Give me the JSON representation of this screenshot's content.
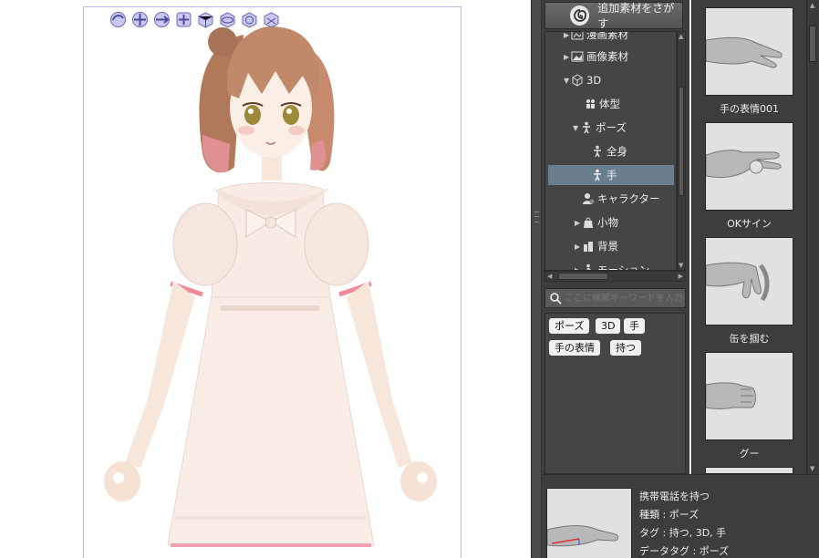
{
  "toolbar3d": {
    "icons": [
      "camera-rotate-icon",
      "camera-pan-icon",
      "camera-dolly-icon",
      "object-move-icon",
      "object-rotate-x-icon",
      "object-rotate-y-icon",
      "object-rotate-z-icon",
      "object-scale-icon"
    ]
  },
  "material_panel": {
    "add_button_label": "追加素材をさがす",
    "tree": {
      "items": [
        {
          "label": "漫画素材",
          "level": 1,
          "expanded": false
        },
        {
          "label": "画像素材",
          "level": 1,
          "expanded": false
        },
        {
          "label": "3D",
          "level": 1,
          "expanded": true
        },
        {
          "label": "体型",
          "level": 2,
          "expanded": null
        },
        {
          "label": "ポーズ",
          "level": 2,
          "expanded": true
        },
        {
          "label": "全身",
          "level": 3,
          "expanded": null
        },
        {
          "label": "手",
          "level": 3,
          "expanded": null,
          "selected": true
        },
        {
          "label": "キャラクター",
          "level": 2,
          "expanded": null
        },
        {
          "label": "小物",
          "level": 2,
          "expanded": false
        },
        {
          "label": "背景",
          "level": 2,
          "expanded": false
        },
        {
          "label": "モーション",
          "level": 2,
          "expanded": false
        }
      ]
    },
    "search": {
      "placeholder": "ここに検索キーワードを入力してください",
      "value": ""
    },
    "tags": [
      "ポーズ",
      "3D",
      "手",
      "手の表情",
      "持つ"
    ]
  },
  "thumbnails": [
    {
      "caption": "手の表情001"
    },
    {
      "caption": "OKサイン"
    },
    {
      "caption": "缶を掴む"
    },
    {
      "caption": "グー"
    }
  ],
  "info": {
    "title": "携帯電話を持つ",
    "kind": "種類 : ポーズ",
    "tags": "タグ : 持つ, 3D, 手",
    "data_tags": "データタグ : ポーズ"
  },
  "colors": {
    "panel_bg": "#3d3d3d",
    "selection": "#6b7e8e",
    "page_border": "#b8b8e0"
  }
}
